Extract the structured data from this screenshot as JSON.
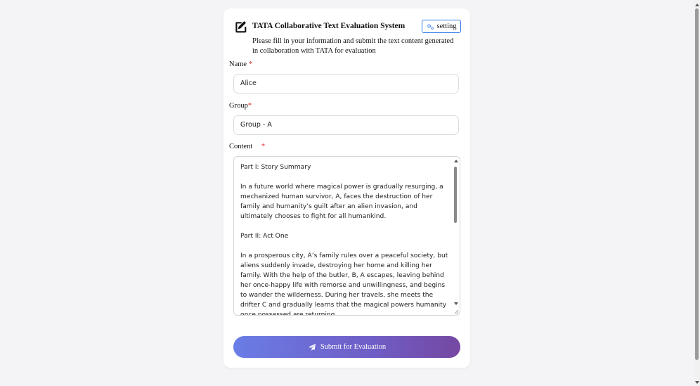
{
  "header": {
    "icon": "edit-icon",
    "title": "TATA Collaborative Text Evaluation System",
    "setting_label": "setting",
    "setting_icon": "gears-icon",
    "subtitle": "Please fill in your information and submit the text content generated in collaboration with TATA for evaluation"
  },
  "form": {
    "name_label": "Name",
    "name_value": "Alice",
    "group_label": "Group",
    "group_value": "Group - A",
    "content_label": "Content",
    "required_mark": "*",
    "content_paragraphs": [
      "Part I: Story Summary",
      "In a future world where magical power is gradually resurging, a mechanized human survivor, A, faces the destruction of her family and humanity’s guilt after an alien invasion, and ultimately chooses to fight for all humankind.",
      "Part II: Act One",
      "In a prosperous city, A’s family rules over a peaceful society, but aliens suddenly invade, destroying her home and killing her family. With the help of the butler, B, A escapes, leaving behind her once-happy life with remorse and unwillingness, and begins to wander the wilderness. During her travels, she meets the drifter C and gradually learns that the magical powers humanity once possessed are returning."
    ]
  },
  "submit": {
    "label": "Submit for Evaluation",
    "icon": "paper-plane-icon"
  },
  "colors": {
    "accent_border": "#2f7be8",
    "required": "#e02424",
    "button_gradient_start": "#6a7de6",
    "button_gradient_end": "#7548a2"
  }
}
